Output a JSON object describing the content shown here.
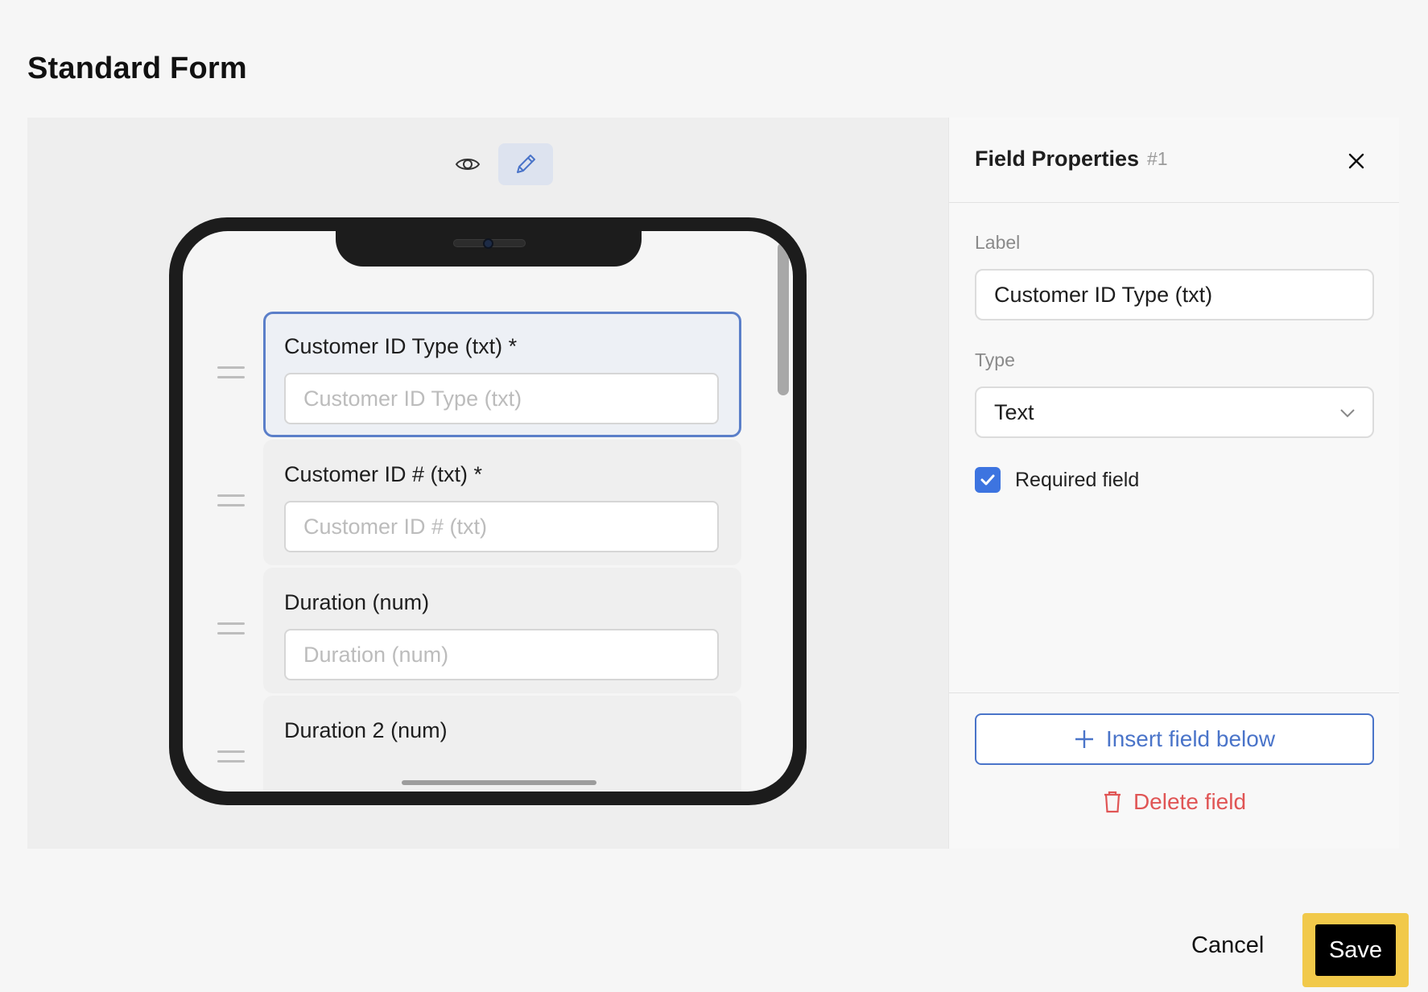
{
  "page": {
    "title": "Standard Form"
  },
  "toolbar": {
    "preview_icon": "eye-icon",
    "edit_icon": "pencil-icon",
    "active_mode": "edit"
  },
  "form_fields": [
    {
      "label": "Customer ID Type (txt) *",
      "placeholder": "Customer ID Type (txt)",
      "selected": true
    },
    {
      "label": "Customer ID # (txt) *",
      "placeholder": "Customer ID # (txt)",
      "selected": false
    },
    {
      "label": "Duration (num)",
      "placeholder": "Duration (num)",
      "selected": false
    },
    {
      "label": "Duration 2 (num)",
      "placeholder": "",
      "selected": false
    }
  ],
  "panel": {
    "title": "Field Properties",
    "field_id": "#1",
    "label_caption": "Label",
    "label_value": "Customer ID Type (txt)",
    "type_caption": "Type",
    "type_value": "Text",
    "required_label": "Required field",
    "required_checked": true,
    "insert_label": "Insert field below",
    "delete_label": "Delete field"
  },
  "footer": {
    "cancel_label": "Cancel",
    "save_label": "Save"
  },
  "colors": {
    "accent": "#4a74c9",
    "checkbox": "#3d74e0",
    "danger": "#e05555",
    "focus_ring": "#f1c94a"
  }
}
